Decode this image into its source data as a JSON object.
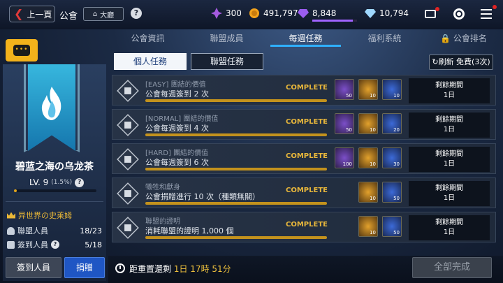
{
  "header": {
    "back_label": "上一頁",
    "section": "公會",
    "lobby_label": "大廳",
    "help": "?",
    "resources": [
      {
        "icon": "purple-crystal-icon",
        "value": "300",
        "color": "#a55be0"
      },
      {
        "icon": "gold-coin-icon",
        "value": "491,797",
        "color": "#f2a21c"
      },
      {
        "icon": "purple-gem-icon",
        "value": "8,848",
        "color": "#9a5df0",
        "progress": 0.9
      },
      {
        "icon": "diamond-icon",
        "value": "10,794",
        "color": "#9fd8ff"
      }
    ]
  },
  "tabs": [
    {
      "label": "公會資訊"
    },
    {
      "label": "聯盟成員"
    },
    {
      "label": "每週任務"
    },
    {
      "label": "福利系統"
    },
    {
      "label": "公會排名"
    }
  ],
  "guild": {
    "name": "碧蓝之海の乌龙茶",
    "level": "LV. 9",
    "level_pct": "(1.5%)",
    "exp_progress": 0.015,
    "leader": "异世界の史莱姆",
    "members_label": "聯盟人員",
    "members_value": "18/23",
    "checkin_label": "簽到人員",
    "checkin_value": "5/18",
    "btn_checkin": "簽到人員",
    "btn_donate": "捐贈"
  },
  "sub_tabs": [
    {
      "label": "個人任務"
    },
    {
      "label": "聯盟任務"
    }
  ],
  "refresh_label": "刷新 免費(3次)",
  "tasks": [
    {
      "sub": "[EASY] 團結的價值",
      "title": "公會每週簽到 2 次",
      "status": "COMPLETE",
      "rewards": [
        {
          "type": "purple",
          "qty": "50"
        },
        {
          "type": "gold",
          "qty": "10"
        },
        {
          "type": "blue",
          "qty": "10"
        }
      ],
      "remain_label": "剩餘期間",
      "remain": "1日"
    },
    {
      "sub": "[NORMAL] 團結的價值",
      "title": "公會每週簽到 4 次",
      "status": "COMPLETE",
      "rewards": [
        {
          "type": "purple",
          "qty": "50"
        },
        {
          "type": "gold",
          "qty": "10"
        },
        {
          "type": "blue",
          "qty": "20"
        }
      ],
      "remain_label": "剩餘期間",
      "remain": "1日"
    },
    {
      "sub": "[HARD] 團結的價值",
      "title": "公會每週簽到 6 次",
      "status": "COMPLETE",
      "rewards": [
        {
          "type": "purple",
          "qty": "100"
        },
        {
          "type": "gold",
          "qty": "10"
        },
        {
          "type": "blue",
          "qty": "30"
        }
      ],
      "remain_label": "剩餘期間",
      "remain": "1日"
    },
    {
      "sub": "犧牲和獻身",
      "title": "公會捐贈進行 10 次（種類無關）",
      "status": "COMPLETE",
      "rewards": [
        {
          "type": "gold",
          "qty": "10"
        },
        {
          "type": "blue",
          "qty": "50"
        }
      ],
      "remain_label": "剩餘期間",
      "remain": "1日"
    },
    {
      "sub": "聯盟的證明",
      "title": "消耗聯盟的證明 1,000 個",
      "status": "COMPLETE",
      "rewards": [
        {
          "type": "gold",
          "qty": "10"
        },
        {
          "type": "blue",
          "qty": "50"
        }
      ],
      "remain_label": "剩餘期間",
      "remain": "1日"
    }
  ],
  "footer": {
    "reset_label": "距重置還剩",
    "reset_time": "1日 17時 51分",
    "complete_all": "全部完成"
  }
}
